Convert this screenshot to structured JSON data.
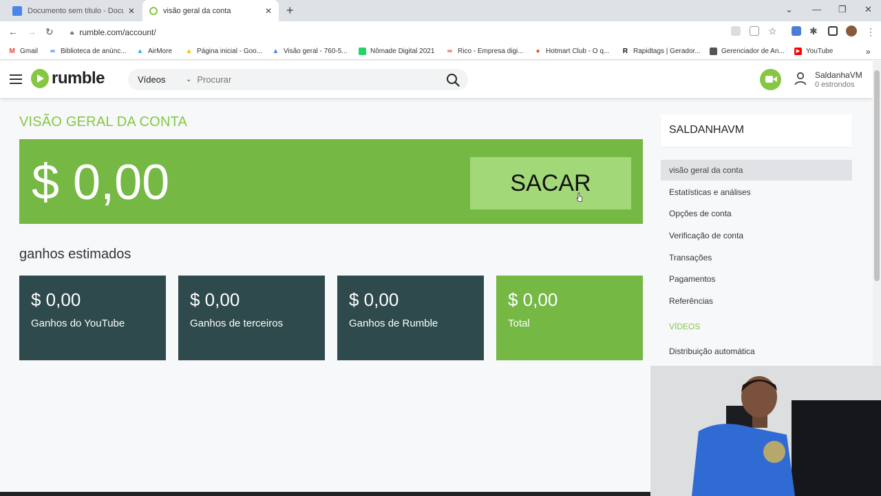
{
  "browser": {
    "tabs": [
      {
        "title": "Documento sem título - Docum",
        "icon_color": "#4a86e8",
        "active": false
      },
      {
        "title": "visão geral da conta",
        "icon_color": "#85c742",
        "active": true
      }
    ],
    "url": "rumble.com/account/",
    "bookmarks": [
      {
        "label": "Gmail",
        "icon": "gmail-icon",
        "color": "#ea4335",
        "glyph": "M"
      },
      {
        "label": "Biblioteca de anúnc...",
        "icon": "meta-icon",
        "color": "#1877f2",
        "glyph": "∞"
      },
      {
        "label": "AirMore",
        "icon": "airmore-icon",
        "color": "#29b6f6",
        "glyph": "▲"
      },
      {
        "label": "Página inicial - Goo...",
        "icon": "google-ads-icon",
        "color": "#fbbc04",
        "glyph": "▲"
      },
      {
        "label": "Visão geral - 760-5...",
        "icon": "google-ads-icon",
        "color": "#4285f4",
        "glyph": "▲"
      },
      {
        "label": "Nômade Digital 2021",
        "icon": "whatsapp-icon",
        "color": "#25d366",
        "glyph": "●"
      },
      {
        "label": "Rico - Empresa digi...",
        "icon": "rico-icon",
        "color": "#e53935",
        "glyph": "∞"
      },
      {
        "label": "Hotmart Club - O q...",
        "icon": "hotmart-icon",
        "color": "#f04e23",
        "glyph": "●"
      },
      {
        "label": "Rapidtags | Gerador...",
        "icon": "rapidtags-icon",
        "color": "#111111",
        "glyph": "R"
      },
      {
        "label": "Gerenciador de An...",
        "icon": "ads-manager-icon",
        "color": "#555555",
        "glyph": "▣"
      },
      {
        "label": "YouTube",
        "icon": "youtube-icon",
        "color": "#ff0000",
        "glyph": "▶"
      }
    ]
  },
  "header": {
    "logo_text": "rumble",
    "search_category": "Vídeos",
    "search_placeholder": "Procurar",
    "username": "SaldanhaVM",
    "credits": "0 estrondos"
  },
  "main": {
    "title": "VISÃO GERAL DA CONTA",
    "balance": "$ 0,00",
    "withdraw_label": "SACAR",
    "earnings_title": "ganhos estimados",
    "cards": [
      {
        "value": "$ 0,00",
        "label": "Ganhos do YouTube"
      },
      {
        "value": "$ 0,00",
        "label": "Ganhos de terceiros"
      },
      {
        "value": "$ 0,00",
        "label": "Ganhos de Rumble"
      },
      {
        "value": "$ 0,00",
        "label": "Total"
      }
    ]
  },
  "sidebar": {
    "account_name": "SALDANHAVM",
    "items": [
      {
        "label": "visão geral da conta",
        "active": true
      },
      {
        "label": "Estatísticas e análises"
      },
      {
        "label": "Opções de conta"
      },
      {
        "label": "Verificação de conta"
      },
      {
        "label": "Transações"
      },
      {
        "label": "Pagamentos"
      },
      {
        "label": "Referências"
      },
      {
        "label": "VÍDEOS",
        "section": true
      },
      {
        "label": "Distribuição automática"
      }
    ]
  },
  "colors": {
    "accent": "#85c742",
    "balance_bg": "#75b844",
    "card_dark": "#2f4a4c"
  }
}
